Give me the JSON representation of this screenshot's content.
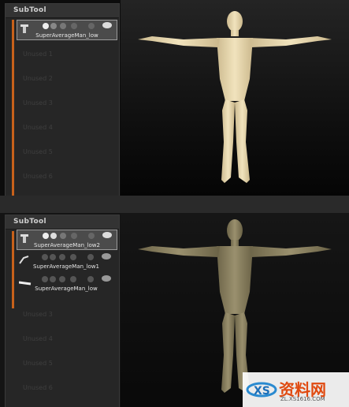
{
  "top_panel": {
    "title": "SubTool",
    "slots": [
      {
        "label": "SuperAverageMan_low",
        "active": true
      }
    ],
    "unused": [
      "Unused 1",
      "Unused 2",
      "Unused 3",
      "Unused 4",
      "Unused 5",
      "Unused 6"
    ]
  },
  "bottom_panel": {
    "title": "SubTool",
    "slots": [
      {
        "label": "SuperAverageMan_low2",
        "active": true
      },
      {
        "label": "SuperAverageMan_low1",
        "active": false
      },
      {
        "label": "SuperAverageMan_low",
        "active": false
      }
    ],
    "unused": [
      "Unused 3",
      "Unused 4",
      "Unused 5",
      "Unused 6"
    ]
  },
  "colors": {
    "accent": "#c8611a",
    "skin_top": "#e9d8b0",
    "skin_bottom": "#8b8262"
  },
  "watermark": {
    "text": "资料网",
    "url": "ZL.XS1616.COM"
  }
}
